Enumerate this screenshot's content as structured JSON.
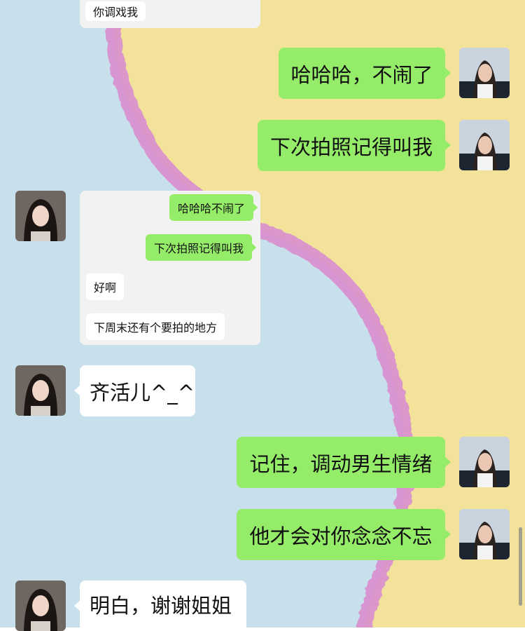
{
  "colors": {
    "sky_blue": "#c7e0ec",
    "sand_yellow": "#f2e29a",
    "pink_wave": "#d98fcf",
    "my_bubble": "#95ec69",
    "their_bubble": "#ffffff",
    "quote_card": "#f2f2f2"
  },
  "icons": {
    "my_avatar": "portrait-woman-dark-hair-icon",
    "their_avatar": "portrait-woman-long-hair-icon"
  },
  "messages": [
    {
      "sender": "them",
      "kind": "partial-card",
      "text": "你调戏我"
    },
    {
      "sender": "me",
      "text": "哈哈哈，不闹了"
    },
    {
      "sender": "me",
      "text": "下次拍照记得叫我"
    },
    {
      "sender": "them",
      "kind": "forwarded-card",
      "items": [
        {
          "sender": "me",
          "text": "哈哈哈不闹了"
        },
        {
          "sender": "me",
          "text": "下次拍照记得叫我"
        },
        {
          "sender": "them",
          "text": "好啊"
        },
        {
          "sender": "them",
          "text": "下周末还有个要拍的地方"
        }
      ]
    },
    {
      "sender": "them",
      "text": "齐活儿^_^"
    },
    {
      "sender": "me",
      "text": "记住，调动男生情绪"
    },
    {
      "sender": "me",
      "text": "他才会对你念念不忘"
    },
    {
      "sender": "them",
      "text": "明白，谢谢姐姐"
    }
  ]
}
